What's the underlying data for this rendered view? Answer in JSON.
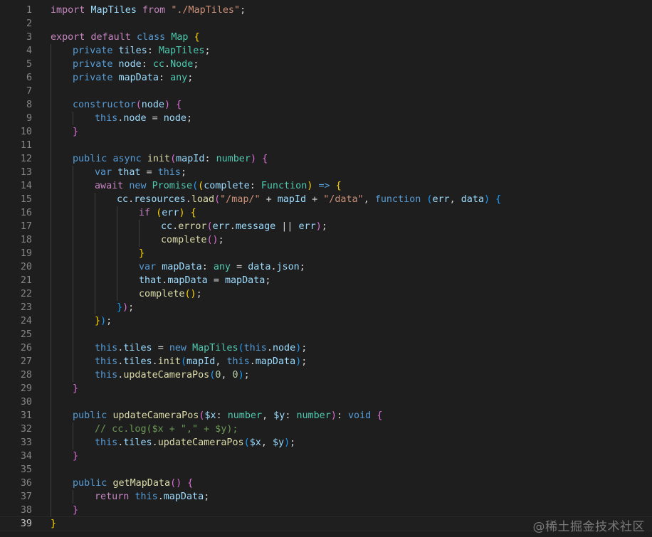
{
  "editor": {
    "current_line": 39,
    "lines": [
      {
        "n": "1",
        "indent": 0,
        "tokens": [
          [
            "import ",
            "c"
          ],
          [
            "MapTiles ",
            "v"
          ],
          [
            "from ",
            "c"
          ],
          [
            "\"./MapTiles\"",
            "s"
          ],
          [
            ";",
            "p"
          ]
        ]
      },
      {
        "n": "2",
        "indent": 0,
        "tokens": []
      },
      {
        "n": "3",
        "indent": 0,
        "tokens": [
          [
            "export ",
            "c"
          ],
          [
            "default ",
            "c"
          ],
          [
            "class ",
            "k"
          ],
          [
            "Map ",
            "t"
          ],
          [
            "{",
            "b1"
          ]
        ]
      },
      {
        "n": "4",
        "indent": 1,
        "tokens": [
          [
            "private ",
            "k"
          ],
          [
            "tiles",
            "v"
          ],
          [
            ": ",
            "p"
          ],
          [
            "MapTiles",
            "t"
          ],
          [
            ";",
            "p"
          ]
        ]
      },
      {
        "n": "5",
        "indent": 1,
        "tokens": [
          [
            "private ",
            "k"
          ],
          [
            "node",
            "v"
          ],
          [
            ": ",
            "p"
          ],
          [
            "cc",
            "t"
          ],
          [
            ".",
            "p"
          ],
          [
            "Node",
            "t"
          ],
          [
            ";",
            "p"
          ]
        ]
      },
      {
        "n": "6",
        "indent": 1,
        "tokens": [
          [
            "private ",
            "k"
          ],
          [
            "mapData",
            "v"
          ],
          [
            ": ",
            "p"
          ],
          [
            "any",
            "t"
          ],
          [
            ";",
            "p"
          ]
        ]
      },
      {
        "n": "7",
        "indent": 1,
        "tokens": []
      },
      {
        "n": "8",
        "indent": 1,
        "tokens": [
          [
            "constructor",
            "k"
          ],
          [
            "(",
            "b2"
          ],
          [
            "node",
            "v"
          ],
          [
            ") ",
            "b2"
          ],
          [
            "{",
            "b2"
          ]
        ]
      },
      {
        "n": "9",
        "indent": 2,
        "tokens": [
          [
            "this",
            "k"
          ],
          [
            ".",
            "p"
          ],
          [
            "node ",
            "v"
          ],
          [
            "= ",
            "p"
          ],
          [
            "node",
            "v"
          ],
          [
            ";",
            "p"
          ]
        ]
      },
      {
        "n": "10",
        "indent": 1,
        "tokens": [
          [
            "}",
            "b2"
          ]
        ]
      },
      {
        "n": "11",
        "indent": 1,
        "tokens": []
      },
      {
        "n": "12",
        "indent": 1,
        "tokens": [
          [
            "public ",
            "k"
          ],
          [
            "async ",
            "k"
          ],
          [
            "init",
            "f"
          ],
          [
            "(",
            "b2"
          ],
          [
            "mapId",
            "v"
          ],
          [
            ": ",
            "p"
          ],
          [
            "number",
            "t"
          ],
          [
            ") ",
            "b2"
          ],
          [
            "{",
            "b2"
          ]
        ]
      },
      {
        "n": "13",
        "indent": 2,
        "tokens": [
          [
            "var ",
            "k"
          ],
          [
            "that ",
            "v"
          ],
          [
            "= ",
            "p"
          ],
          [
            "this",
            "k"
          ],
          [
            ";",
            "p"
          ]
        ]
      },
      {
        "n": "14",
        "indent": 2,
        "tokens": [
          [
            "await ",
            "c"
          ],
          [
            "new ",
            "k"
          ],
          [
            "Promise",
            "t"
          ],
          [
            "(",
            "b3"
          ],
          [
            "(",
            "b1"
          ],
          [
            "complete",
            "v"
          ],
          [
            ": ",
            "p"
          ],
          [
            "Function",
            "t"
          ],
          [
            ") ",
            "b1"
          ],
          [
            "=> ",
            "k"
          ],
          [
            "{",
            "b1"
          ]
        ]
      },
      {
        "n": "15",
        "indent": 3,
        "tokens": [
          [
            "cc",
            "v"
          ],
          [
            ".",
            "p"
          ],
          [
            "resources",
            "v"
          ],
          [
            ".",
            "p"
          ],
          [
            "load",
            "f"
          ],
          [
            "(",
            "b2"
          ],
          [
            "\"/map/\" ",
            "s"
          ],
          [
            "+ ",
            "p"
          ],
          [
            "mapId ",
            "v"
          ],
          [
            "+ ",
            "p"
          ],
          [
            "\"/data\"",
            "s"
          ],
          [
            ", ",
            "p"
          ],
          [
            "function ",
            "k"
          ],
          [
            "(",
            "b3"
          ],
          [
            "err",
            "v"
          ],
          [
            ", ",
            "p"
          ],
          [
            "data",
            "v"
          ],
          [
            ") ",
            "b3"
          ],
          [
            "{",
            "b3"
          ]
        ]
      },
      {
        "n": "16",
        "indent": 4,
        "tokens": [
          [
            "if ",
            "c"
          ],
          [
            "(",
            "b1"
          ],
          [
            "err",
            "v"
          ],
          [
            ") ",
            "b1"
          ],
          [
            "{",
            "b1"
          ]
        ]
      },
      {
        "n": "17",
        "indent": 5,
        "tokens": [
          [
            "cc",
            "v"
          ],
          [
            ".",
            "p"
          ],
          [
            "error",
            "f"
          ],
          [
            "(",
            "b2"
          ],
          [
            "err",
            "v"
          ],
          [
            ".",
            "p"
          ],
          [
            "message ",
            "v"
          ],
          [
            "|| ",
            "p"
          ],
          [
            "err",
            "v"
          ],
          [
            ")",
            "b2"
          ],
          [
            ";",
            "p"
          ]
        ]
      },
      {
        "n": "18",
        "indent": 5,
        "tokens": [
          [
            "complete",
            "f"
          ],
          [
            "()",
            "b2"
          ],
          [
            ";",
            "p"
          ]
        ]
      },
      {
        "n": "19",
        "indent": 4,
        "tokens": [
          [
            "}",
            "b1"
          ]
        ]
      },
      {
        "n": "20",
        "indent": 4,
        "tokens": [
          [
            "var ",
            "k"
          ],
          [
            "mapData",
            "v"
          ],
          [
            ": ",
            "p"
          ],
          [
            "any ",
            "t"
          ],
          [
            "= ",
            "p"
          ],
          [
            "data",
            "v"
          ],
          [
            ".",
            "p"
          ],
          [
            "json",
            "v"
          ],
          [
            ";",
            "p"
          ]
        ]
      },
      {
        "n": "21",
        "indent": 4,
        "tokens": [
          [
            "that",
            "v"
          ],
          [
            ".",
            "p"
          ],
          [
            "mapData ",
            "v"
          ],
          [
            "= ",
            "p"
          ],
          [
            "mapData",
            "v"
          ],
          [
            ";",
            "p"
          ]
        ]
      },
      {
        "n": "22",
        "indent": 4,
        "tokens": [
          [
            "complete",
            "f"
          ],
          [
            "()",
            "b1"
          ],
          [
            ";",
            "p"
          ]
        ]
      },
      {
        "n": "23",
        "indent": 3,
        "tokens": [
          [
            "}",
            "b3"
          ],
          [
            ")",
            "b2"
          ],
          [
            ";",
            "p"
          ]
        ]
      },
      {
        "n": "24",
        "indent": 2,
        "tokens": [
          [
            "}",
            "b1"
          ],
          [
            ")",
            "b3"
          ],
          [
            ";",
            "p"
          ]
        ]
      },
      {
        "n": "25",
        "indent": 2,
        "tokens": []
      },
      {
        "n": "26",
        "indent": 2,
        "tokens": [
          [
            "this",
            "k"
          ],
          [
            ".",
            "p"
          ],
          [
            "tiles ",
            "v"
          ],
          [
            "= ",
            "p"
          ],
          [
            "new ",
            "k"
          ],
          [
            "MapTiles",
            "t"
          ],
          [
            "(",
            "b3"
          ],
          [
            "this",
            "k"
          ],
          [
            ".",
            "p"
          ],
          [
            "node",
            "v"
          ],
          [
            ")",
            "b3"
          ],
          [
            ";",
            "p"
          ]
        ]
      },
      {
        "n": "27",
        "indent": 2,
        "tokens": [
          [
            "this",
            "k"
          ],
          [
            ".",
            "p"
          ],
          [
            "tiles",
            "v"
          ],
          [
            ".",
            "p"
          ],
          [
            "init",
            "f"
          ],
          [
            "(",
            "b3"
          ],
          [
            "mapId",
            "v"
          ],
          [
            ", ",
            "p"
          ],
          [
            "this",
            "k"
          ],
          [
            ".",
            "p"
          ],
          [
            "mapData",
            "v"
          ],
          [
            ")",
            "b3"
          ],
          [
            ";",
            "p"
          ]
        ]
      },
      {
        "n": "28",
        "indent": 2,
        "tokens": [
          [
            "this",
            "k"
          ],
          [
            ".",
            "p"
          ],
          [
            "updateCameraPos",
            "f"
          ],
          [
            "(",
            "b3"
          ],
          [
            "0",
            "n"
          ],
          [
            ", ",
            "p"
          ],
          [
            "0",
            "n"
          ],
          [
            ")",
            "b3"
          ],
          [
            ";",
            "p"
          ]
        ]
      },
      {
        "n": "29",
        "indent": 1,
        "tokens": [
          [
            "}",
            "b2"
          ]
        ]
      },
      {
        "n": "30",
        "indent": 1,
        "tokens": []
      },
      {
        "n": "31",
        "indent": 1,
        "tokens": [
          [
            "public ",
            "k"
          ],
          [
            "updateCameraPos",
            "f"
          ],
          [
            "(",
            "b2"
          ],
          [
            "$x",
            "v"
          ],
          [
            ": ",
            "p"
          ],
          [
            "number",
            "t"
          ],
          [
            ", ",
            "p"
          ],
          [
            "$y",
            "v"
          ],
          [
            ": ",
            "p"
          ],
          [
            "number",
            "t"
          ],
          [
            ")",
            "b2"
          ],
          [
            ": ",
            "p"
          ],
          [
            "void ",
            "k"
          ],
          [
            "{",
            "b2"
          ]
        ]
      },
      {
        "n": "32",
        "indent": 2,
        "tokens": [
          [
            "// cc.log($x + \",\" + $y);",
            "cm"
          ]
        ]
      },
      {
        "n": "33",
        "indent": 2,
        "tokens": [
          [
            "this",
            "k"
          ],
          [
            ".",
            "p"
          ],
          [
            "tiles",
            "v"
          ],
          [
            ".",
            "p"
          ],
          [
            "updateCameraPos",
            "f"
          ],
          [
            "(",
            "b3"
          ],
          [
            "$x",
            "v"
          ],
          [
            ", ",
            "p"
          ],
          [
            "$y",
            "v"
          ],
          [
            ")",
            "b3"
          ],
          [
            ";",
            "p"
          ]
        ]
      },
      {
        "n": "34",
        "indent": 1,
        "tokens": [
          [
            "}",
            "b2"
          ]
        ]
      },
      {
        "n": "35",
        "indent": 1,
        "tokens": []
      },
      {
        "n": "36",
        "indent": 1,
        "tokens": [
          [
            "public ",
            "k"
          ],
          [
            "getMapData",
            "f"
          ],
          [
            "() ",
            "b2"
          ],
          [
            "{",
            "b2"
          ]
        ]
      },
      {
        "n": "37",
        "indent": 2,
        "tokens": [
          [
            "return ",
            "c"
          ],
          [
            "this",
            "k"
          ],
          [
            ".",
            "p"
          ],
          [
            "mapData",
            "v"
          ],
          [
            ";",
            "p"
          ]
        ]
      },
      {
        "n": "38",
        "indent": 1,
        "tokens": [
          [
            "}",
            "b2"
          ]
        ]
      },
      {
        "n": "39",
        "indent": 0,
        "tokens": [
          [
            "}",
            "b1"
          ]
        ]
      }
    ]
  },
  "watermark": "@稀土掘金技术社区"
}
